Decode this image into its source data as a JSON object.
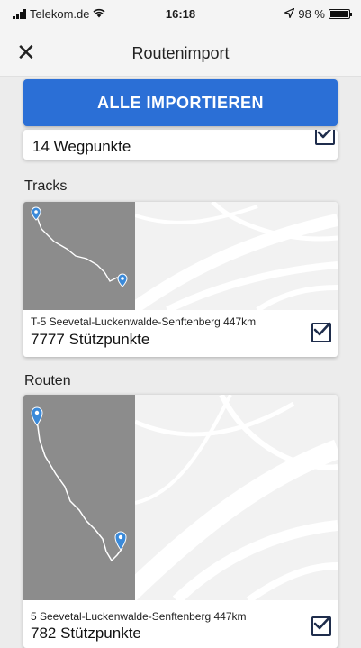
{
  "status_bar": {
    "carrier": "Telekom.de",
    "time": "16:18",
    "battery": "98 %",
    "battery_level": 0.98,
    "icons": [
      "signal-icon",
      "wifi-icon",
      "location-icon",
      "battery-icon"
    ]
  },
  "header": {
    "title": "Routenimport",
    "close_icon": "close-icon"
  },
  "import_button": {
    "label": "ALLE IMPORTIEREN"
  },
  "waypoints_card": {
    "count": "14 Wegpunkte",
    "checked": true
  },
  "tracks": {
    "section_label": "Tracks",
    "items": [
      {
        "name": "T-5 Seevetal-Luckenwalde-Senftenberg 447km",
        "count": "7777 Stützpunkte",
        "checked": true
      }
    ]
  },
  "routes": {
    "section_label": "Routen",
    "items": [
      {
        "name": "5 Seevetal-Luckenwalde-Senftenberg 447km",
        "count": "782 Stützpunkte",
        "checked": true
      }
    ]
  },
  "colors": {
    "accent": "#2b6fd6",
    "checkbox": "#1f2d4c",
    "background": "#ececec",
    "map_shade": "#8c8c8c",
    "card": "#ffffff"
  }
}
